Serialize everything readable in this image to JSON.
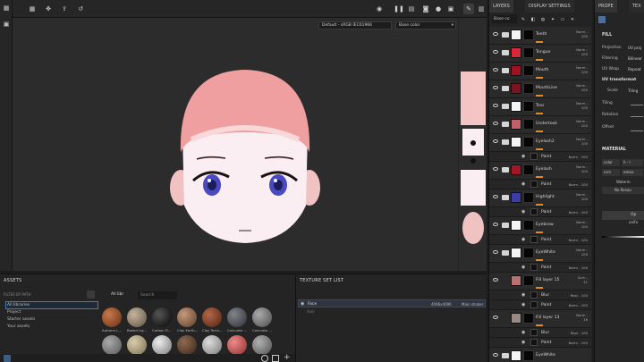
{
  "toolbar": {
    "left_tools": [
      "grid-icon",
      "apps-icon",
      "move-icon",
      "export-icon",
      "history-icon"
    ],
    "right_tools": [
      "camera-record-icon",
      "pause-icon",
      "display-icon",
      "render-icon",
      "material-ball-icon",
      "camera-icon",
      "brush-icon",
      "viewport-mode-icon"
    ]
  },
  "viewport": {
    "colorspace_select": "Default - sRGB IEC61966",
    "channel_select": "Base color"
  },
  "assets": {
    "title": "ASSETS",
    "filter_placeholder": "FILTER BY PATH",
    "libraries": [
      "All libraries",
      "Project",
      "Starter assets",
      "Your assets"
    ],
    "breadcrumb": "All libr",
    "search_placeholder": "Search",
    "materials": [
      {
        "label": "Autumn L...",
        "color": "#9a4a2a"
      },
      {
        "label": "Baked Lig...",
        "color": "#8a7b67"
      },
      {
        "label": "Carbon Fi...",
        "color": "#151515"
      },
      {
        "label": "Clay Earth...",
        "color": "#8a6a52"
      },
      {
        "label": "Clay Terra...",
        "color": "#7a3f29"
      },
      {
        "label": "Concrete ...",
        "color": "#4f5258"
      },
      {
        "label": "Concrete ...",
        "color": "#7b7b7b"
      }
    ],
    "materials_row2": [
      "#8a8a8a",
      "#b6a98a",
      "#d8d8d8",
      "#6b4a34",
      "#c9c9c9",
      "#d96a6a",
      "#8f8f8f"
    ]
  },
  "texture_set_list": {
    "title": "TEXTURE SET LIST",
    "rows": [
      {
        "name": "Face",
        "resolution": "4096x4096",
        "shader": "Main shader"
      },
      {
        "name": "Hair",
        "resolution": "",
        "shader": ""
      }
    ]
  },
  "layers": {
    "tabs": [
      "LAYERS",
      "DISPLAY SETTINGS"
    ],
    "channel_select": "Base co",
    "items": [
      {
        "name": "Teeth",
        "type": "folder",
        "color": "#f2f2f2",
        "blend": "Norm",
        "opacity": "100"
      },
      {
        "name": "Tongue",
        "type": "folder",
        "color": "#d6283a",
        "blend": "Norm",
        "opacity": "100"
      },
      {
        "name": "Mouth",
        "type": "folder",
        "color": "#a01222",
        "blend": "Norm",
        "opacity": "100"
      },
      {
        "name": "MouthLine",
        "type": "folder",
        "color": "#7a1420",
        "blend": "Norm",
        "opacity": "100"
      },
      {
        "name": "Tear",
        "type": "folder",
        "color": "#f4f4f4",
        "blend": "Norm",
        "opacity": "100"
      },
      {
        "name": "Undertook",
        "type": "folder",
        "color": "#c2606a",
        "blend": "Norm",
        "opacity": "100"
      },
      {
        "name": "Eyelash2",
        "type": "folder",
        "color": "#f4f4f4",
        "blend": "Norm",
        "opacity": "100"
      },
      {
        "name": "Paint",
        "type": "sub",
        "blend": "Norm",
        "opacity": "100"
      },
      {
        "name": "Eyelash",
        "type": "folder",
        "color": "#a01824",
        "blend": "Norm",
        "opacity": "100"
      },
      {
        "name": "Paint",
        "type": "sub",
        "blend": "Norm",
        "opacity": "100"
      },
      {
        "name": "Highlight",
        "type": "folder",
        "color": "#3c3ca8",
        "blend": "Norm",
        "opacity": "100"
      },
      {
        "name": "Paint",
        "type": "sub",
        "blend": "Norm",
        "opacity": "100"
      },
      {
        "name": "Eyebrow",
        "type": "folder",
        "color": "#f4f4f4",
        "blend": "Norm",
        "opacity": "100"
      },
      {
        "name": "Paint",
        "type": "sub",
        "blend": "Norm",
        "opacity": "100"
      },
      {
        "name": "EyeWhite",
        "type": "folder",
        "color": "#f4f4f4",
        "blend": "Norm",
        "opacity": "100"
      },
      {
        "name": "Paint",
        "type": "sub",
        "blend": "Norm",
        "opacity": "100"
      },
      {
        "name": "Fill layer 15",
        "type": "fill",
        "color": "#b87070",
        "blend": "Scrn",
        "opacity": "31"
      },
      {
        "name": "Blur",
        "type": "sub",
        "blend": "Repl",
        "opacity": "100"
      },
      {
        "name": "Paint",
        "type": "sub",
        "blend": "Norm",
        "opacity": "100"
      },
      {
        "name": "Fill layer 13",
        "type": "fill",
        "color": "#9a8a86",
        "blend": "Norm",
        "opacity": "16"
      },
      {
        "name": "Blur",
        "type": "sub",
        "blend": "Repl",
        "opacity": "100"
      },
      {
        "name": "Paint",
        "type": "sub",
        "blend": "Norm",
        "opacity": "100"
      },
      {
        "name": "EyeWhite",
        "type": "folder",
        "color": "#f4f4f4",
        "blend": "",
        "opacity": ""
      }
    ]
  },
  "properties": {
    "tabs": [
      "PROPE",
      "TEX"
    ],
    "fill_title": "FILL",
    "rows": [
      {
        "label": "Projection",
        "value": "UV proj"
      },
      {
        "label": "Filtering",
        "value": "Bilinear"
      },
      {
        "label": "UV Wrap",
        "value": "Repeat"
      }
    ],
    "uv_title": "UV transformat",
    "scale_label": "Scale",
    "scale_value": "Tiling",
    "tiling_label": "Tiling",
    "rotation_label": "Rotation",
    "offset_label": "Offset",
    "material_title": "MATERIAL",
    "color_label": "color",
    "color_value": "h - l",
    "nrm_label": "nrm",
    "nrm_value": "emiss",
    "waterm_label": "Waterm",
    "no_res_label": "No Resou",
    "op_label": "Op",
    "uni_label": "unifo"
  }
}
